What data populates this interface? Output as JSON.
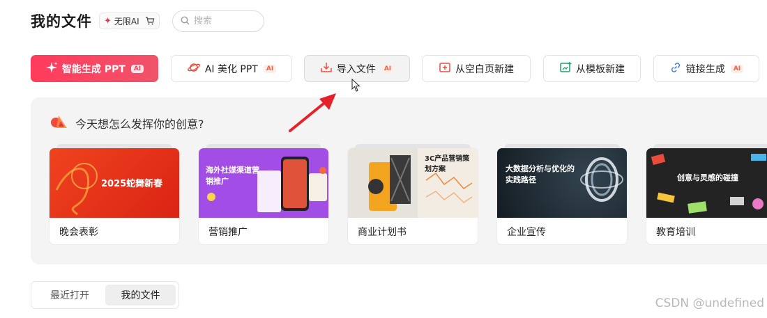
{
  "header": {
    "title": "我的文件",
    "badge_label": "无限AI",
    "search_placeholder": "搜索"
  },
  "actions": [
    {
      "label": "智能生成 PPT",
      "ai": "AI"
    },
    {
      "label": "AI 美化 PPT",
      "ai": "AI"
    },
    {
      "label": "导入文件",
      "ai": "AI"
    },
    {
      "label": "从空白页新建"
    },
    {
      "label": "从模板新建"
    },
    {
      "label": "链接生成",
      "ai": "AI"
    }
  ],
  "prompt": "今天想怎么发挥你的创意?",
  "templates": [
    {
      "label": "晚会表彰",
      "thumb_title": "2025蛇舞新春",
      "color": "#e8321f"
    },
    {
      "label": "营销推广",
      "thumb_title": "海外社媒渠道营销推广",
      "color": "#a24de6"
    },
    {
      "label": "商业计划书",
      "thumb_title": "3C产品营销策划方案",
      "color": "#f3ece2"
    },
    {
      "label": "企业宣传",
      "thumb_title": "大数据分析与优化的实践路径",
      "color": "#1c2730"
    },
    {
      "label": "教育培训",
      "thumb_title": "创意与灵感的碰撞",
      "color": "#232323"
    }
  ],
  "tabs": [
    {
      "label": "最近打开"
    },
    {
      "label": "我的文件"
    }
  ],
  "watermark": "CSDN @undefined",
  "colors": {
    "primary": "#ff3b5c",
    "ai_tag": "#f2614a",
    "panel_bg": "#f4f4f5",
    "arrow": "#e5222a"
  }
}
